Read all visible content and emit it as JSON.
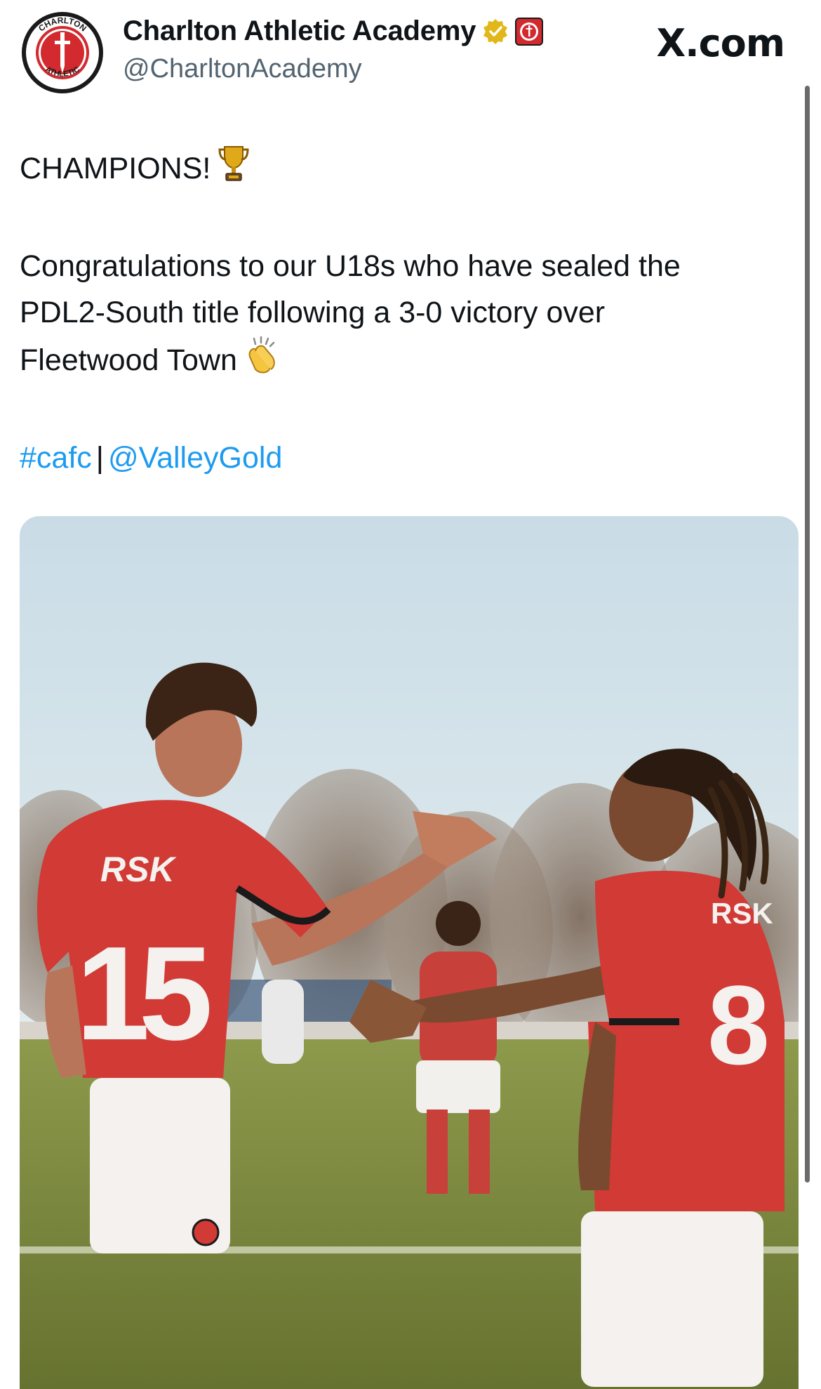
{
  "account": {
    "display_name": "Charlton Athletic Academy",
    "handle": "@CharltonAcademy",
    "crest_text_top": "CHARLTON",
    "crest_text_bottom": "ATHLETIC",
    "verified_badge_color": "#e2b719",
    "affiliate_badge_color": "#d22a2e"
  },
  "site_mark": "X.com",
  "tweet": {
    "headline": "CHAMPIONS!",
    "headline_emoji": "trophy-icon",
    "body_lines": [
      "Congratulations to our U18s who have sealed the",
      "PDL2-South title following a 3-0 victory over",
      "Fleetwood Town"
    ],
    "body_emoji": "clapping-hands-icon",
    "hashtag": "#cafc",
    "separator": "|",
    "mention": "@ValleyGold"
  },
  "photo": {
    "sponsor_left": "RSK",
    "number_left": "15",
    "sponsor_right": "RSK",
    "number_right": "8",
    "kit_color": "#d13a35",
    "shorts_color": "#f4f1ee"
  },
  "colors": {
    "text": "#0f1419",
    "secondary_text": "#536471",
    "link": "#1d9bf0"
  }
}
